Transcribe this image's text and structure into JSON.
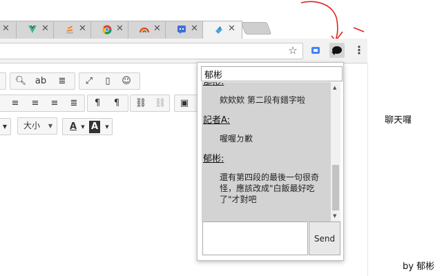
{
  "popup": {
    "name_value": "郁彬",
    "messages": [
      {
        "sender": "郁彬:",
        "text": "欸欸欸 第二段有錯字啦"
      },
      {
        "sender": "記者A:",
        "text": "喔喔ㄉ歉"
      },
      {
        "sender": "郁彬:",
        "text": "還有第四段的最後一句很奇怪，應該改成\"白飯最好吃了\"才對吧"
      }
    ],
    "send_label": "Send"
  },
  "editor": {
    "size_select": "大小"
  },
  "side_label": "聊天囉",
  "footer": "by 郁彬",
  "colors": {
    "accent_blue": "#4285f4",
    "annotation_red": "#e0201a"
  }
}
